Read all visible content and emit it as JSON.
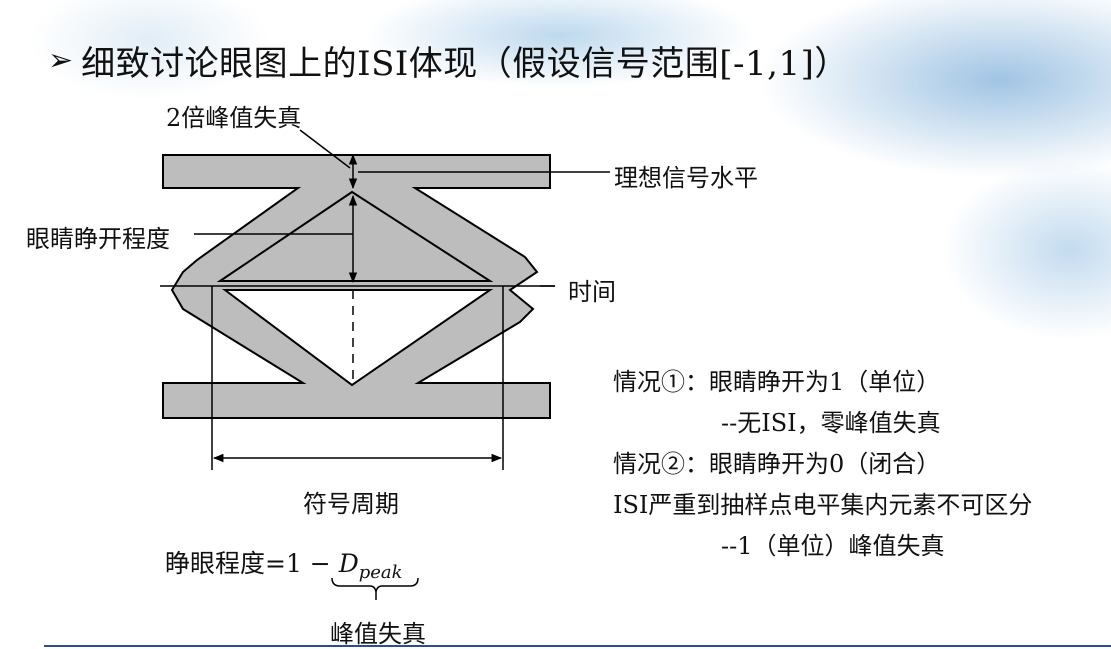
{
  "slide": {
    "bullet": "➢",
    "title": "细致讨论眼图上的ISI体现（假设信号范围[-1,1]）"
  },
  "diagram": {
    "label_peak_distortion_2x": "2倍峰值失真",
    "label_ideal_level": "理想信号水平",
    "label_eye_opening": "眼睛睁开程度",
    "label_time": "时间",
    "label_symbol_period": "符号周期",
    "formula_text": "睁眼程度=1 − ",
    "formula_var": "D",
    "formula_sub": "peak",
    "label_peak_distortion": "峰值失真",
    "colors": {
      "band_fill": "#bdbdbd",
      "stroke": "#000000"
    }
  },
  "cases": {
    "line1": "情况①：眼睛睁开为1（单位）",
    "line2": "--无ISI，零峰值失真",
    "line3": "情况②：眼睛睁开为0（闭合）",
    "line4": "ISI严重到抽样点电平集内元素不可区分",
    "line5": "--1（单位）峰值失真"
  }
}
